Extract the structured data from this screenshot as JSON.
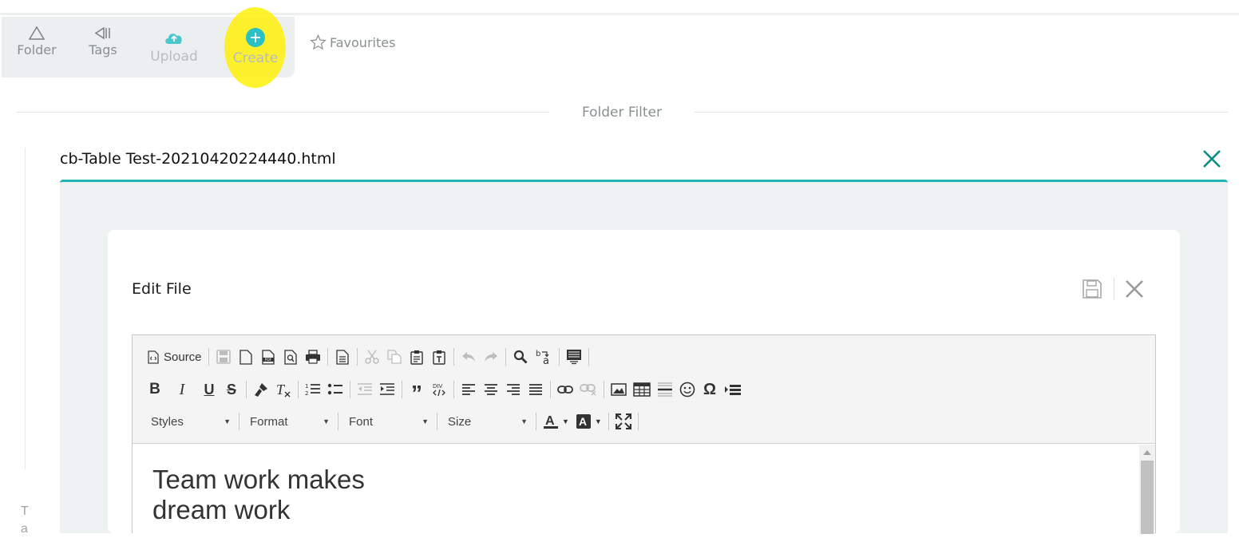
{
  "toolbar": {
    "folder_label": "Folder",
    "tags_label": "Tags",
    "upload_label": "Upload",
    "create_label": "Create",
    "favourites_label": "Favourites"
  },
  "filter": {
    "label": "Folder Filter"
  },
  "side": {
    "letters": "T a"
  },
  "file": {
    "title": "cb-Table Test-20210420224440.html"
  },
  "editor_card": {
    "title": "Edit File"
  },
  "editor": {
    "source_label": "Source",
    "styles_label": "Styles",
    "format_label": "Format",
    "font_label": "Font",
    "size_label": "Size",
    "content_line1": "Team work makes",
    "content_line2": "dream work"
  },
  "colors": {
    "accent": "#1fb5b0",
    "highlight": "#fff000",
    "create_icon": "#2cc0c4",
    "upload_icon": "#4bc6cc"
  },
  "icons": [
    "folder-icon",
    "tags-icon",
    "upload-cloud-icon",
    "create-plus-icon",
    "star-icon",
    "close-icon",
    "save-icon"
  ]
}
